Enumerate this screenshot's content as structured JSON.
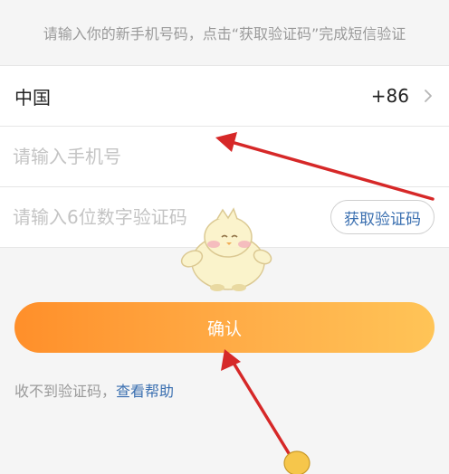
{
  "hint": {
    "text": "请输入你的新手机号码，点击“获取验证码”完成短信验证"
  },
  "country_row": {
    "country": "中国",
    "dial_code": "+86",
    "chevron_icon": "chevron-right-icon"
  },
  "phone_row": {
    "placeholder": "请输入手机号",
    "value": ""
  },
  "code_row": {
    "placeholder": "请输入6位数字验证码",
    "value": "",
    "get_code_label": "获取验证码"
  },
  "confirm": {
    "label": "确认"
  },
  "help": {
    "prefix": "收不到验证码，",
    "link": "查看帮助"
  },
  "colors": {
    "background": "#f5f5f5",
    "link_blue": "#3a6fb0",
    "button_orange_start": "#ff8f2a",
    "button_orange_end": "#ffc457",
    "annotation_red": "#d62828"
  },
  "annotations": {
    "arrow_icon": "red-arrow-icon",
    "mascot_icon": "chick-mascot-icon"
  }
}
